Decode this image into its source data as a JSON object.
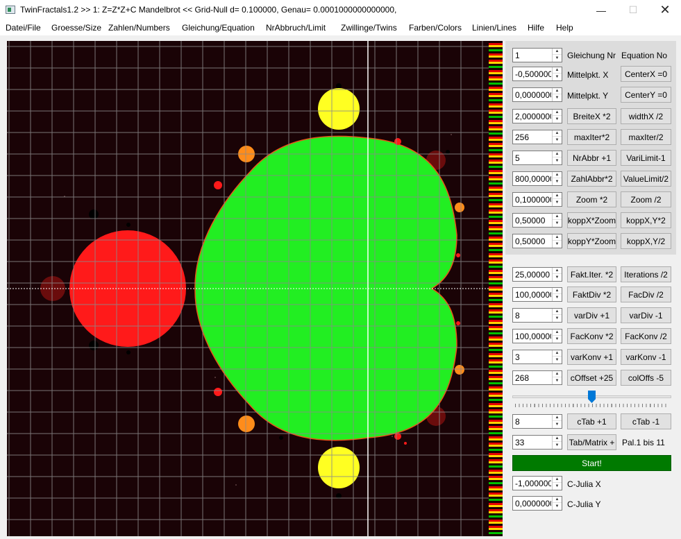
{
  "window": {
    "title": "TwinFractals1.2 >> 1: Z=Z*Z+C Mandelbrot << Grid-Null d= 0.100000, Genau= 0.0001000000000000,",
    "minimize": "—",
    "maximize": "☐",
    "close": "✕"
  },
  "menu": [
    "Datei/File",
    "Groesse/Size",
    "Zahlen/Numbers",
    "Gleichung/Equation",
    "NrAbbruch/Limit",
    "Zwillinge/Twins",
    "Farben/Colors",
    "Linien/Lines",
    "Hilfe",
    "Help"
  ],
  "controls": {
    "equation_nr": "1",
    "equation_label": "Gleichung Nr",
    "equation_label_en": "Equation No",
    "center_x_value": "-0,5000000",
    "center_x_label": "Mittelpkt. X",
    "center_x_btn": "CenterX =0",
    "center_y_value": "0,0000000",
    "center_y_label": "Mittelpkt. Y",
    "center_y_btn": "CenterY =0",
    "width_value": "2,0000000",
    "width_mul_btn": "BreiteX *2",
    "width_div_btn": "widthX /2",
    "maxiter_value": "256",
    "maxiter_mul_btn": "maxIter*2",
    "maxiter_div_btn": "maxIter/2",
    "nrabbr_value": "5",
    "nrabbr_btn": "NrAbbr +1",
    "varilimit_btn": "VariLimit-1",
    "zahlabbr_value": "800,000000",
    "zahlabbr_btn": "ZahlAbbr*2",
    "valuelimit_btn": "ValueLimit/2",
    "zoom_value": "0,1000000",
    "zoom_mul_btn": "Zoom *2",
    "zoom_div_btn": "Zoom /2",
    "koppx_value": "0,50000",
    "koppx_btn": "koppX*Zoom",
    "koppxy_mul_btn": "koppX,Y*2",
    "koppy_value": "0,50000",
    "koppy_btn": "koppY*Zoom",
    "koppxy_div_btn": "koppX,Y/2",
    "faktiter_value": "25,00000",
    "faktiter_btn": "Fakt.Iter. *2",
    "iterations_btn": "Iterations /2",
    "faktdiv_value": "100,000000",
    "faktdiv_btn": "FaktDiv *2",
    "facdiv_btn": "FacDiv /2",
    "vardiv_value": "8",
    "vardiv_inc_btn": "varDiv +1",
    "vardiv_dec_btn": "varDiv -1",
    "fackonv_value": "100,000000",
    "fackonv_mul_btn": "FacKonv *2",
    "fackonv_div_btn": "FacKonv /2",
    "varkonv_value": "3",
    "varkonv_inc_btn": "varKonv +1",
    "varkonv_dec_btn": "varKonv -1",
    "coffset_value": "268",
    "coffset_btn": "cOffset +25",
    "coloffs_btn": "colOffs -5",
    "slider_level": 0.5,
    "ctab_value": "8",
    "ctab_inc_btn": "cTab +1",
    "ctab_dec_btn": "cTab -1",
    "tabmatrix_value": "33",
    "tabmatrix_btn": "Tab/Matrix +",
    "palette_label": "Pal.1 bis 11",
    "start_btn": "Start!",
    "julia_x_value": "-1,0000000",
    "julia_x_label": "C-Julia X",
    "julia_y_value": "0,0000000",
    "julia_y_label": "C-Julia Y"
  },
  "colors": {
    "background": "#1a0306",
    "main_set": "#22ee22",
    "period2": "#ff1a1a",
    "period3": "#ffff22",
    "small_bulbs": "#ff8c1a",
    "grid": "#8a8a8a",
    "start_button": "#007a00"
  }
}
